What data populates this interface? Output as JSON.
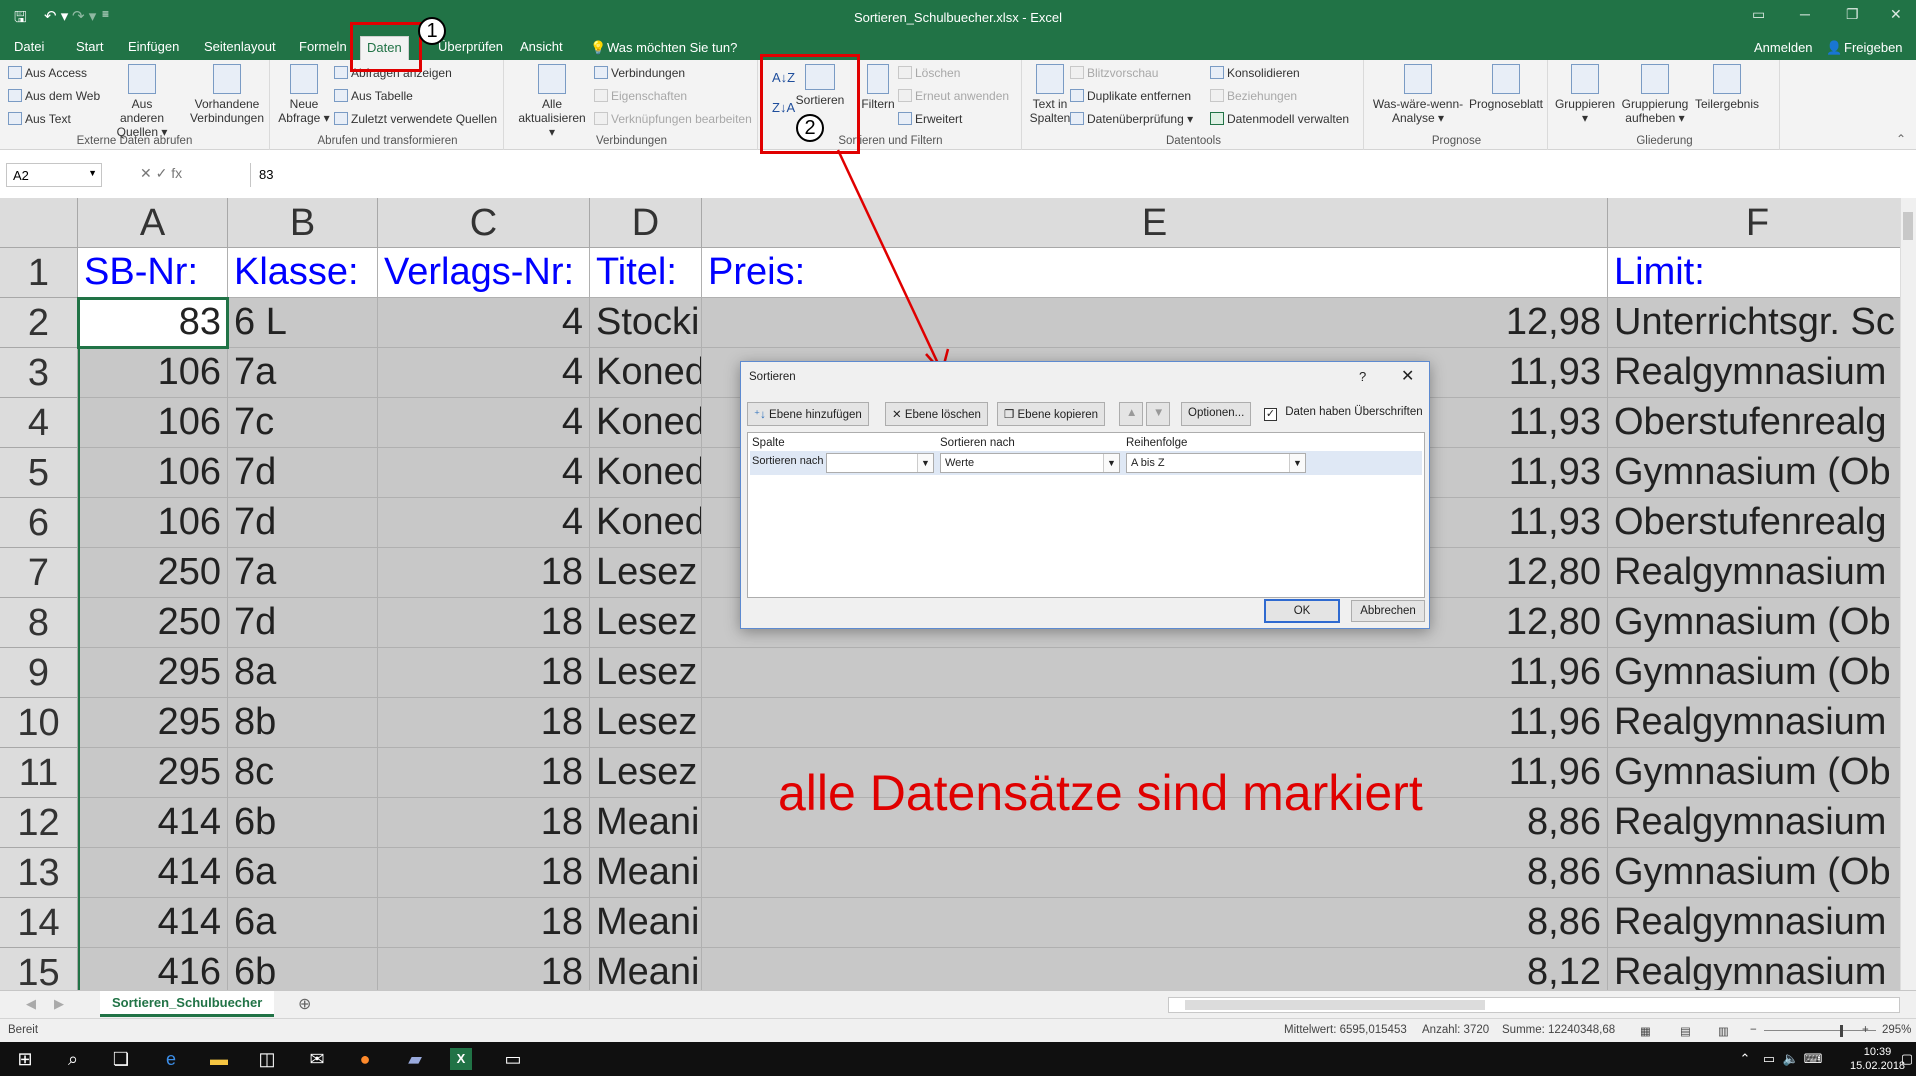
{
  "titlebar": {
    "title": "Sortieren_Schulbuecher.xlsx - Excel",
    "qa_save": "🖫",
    "qa_undo": "↶ ▾",
    "qa_redo": "↷ ▾",
    "qa_more": "≡"
  },
  "menu": {
    "tabs": [
      "Datei",
      "Start",
      "Einfügen",
      "Seitenlayout",
      "Formeln",
      "Daten",
      "Überprüfen",
      "Ansicht"
    ],
    "tell_me": "Was möchten Sie tun?",
    "signin": "Anmelden",
    "share": "Freigeben"
  },
  "ribbon": {
    "ext": {
      "access": "Aus Access",
      "web": "Aus dem Web",
      "text": "Aus Text",
      "other_l1": "Aus anderen",
      "other_l2": "Quellen ▾",
      "existing_l1": "Vorhandene",
      "existing_l2": "Verbindungen",
      "label": "Externe Daten abrufen"
    },
    "transform": {
      "newq_l1": "Neue",
      "newq_l2": "Abfrage ▾",
      "show": "Abfragen anzeigen",
      "table": "Aus Tabelle",
      "recent": "Zuletzt verwendete Quellen",
      "label": "Abrufen und transformieren"
    },
    "connections": {
      "refresh_l1": "Alle",
      "refresh_l2": "aktualisieren ▾",
      "conns": "Verbindungen",
      "props": "Eigenschaften",
      "links": "Verknüpfungen bearbeiten",
      "label": "Verbindungen"
    },
    "sort": {
      "sort": "Sortieren",
      "filter": "Filtern",
      "clear": "Löschen",
      "reapply": "Erneut anwenden",
      "advanced": "Erweitert",
      "label": "Sortieren und Filtern"
    },
    "tools": {
      "ttc_l1": "Text in",
      "ttc_l2": "Spalten",
      "flash": "Blitzvorschau",
      "dupes": "Duplikate entfernen",
      "validate": "Datenüberprüfung ▾",
      "consolidate": "Konsolidieren",
      "relations": "Beziehungen",
      "model": "Datenmodell verwalten",
      "label": "Datentools"
    },
    "forecast": {
      "whatif_l1": "Was-wäre-wenn-",
      "whatif_l2": "Analyse ▾",
      "sheet": "Prognoseblatt",
      "label": "Prognose"
    },
    "outline": {
      "group_l1": "Gruppieren",
      "group_l2": "▾",
      "ungroup_l1": "Gruppierung",
      "ungroup_l2": "aufheben ▾",
      "subtotal": "Teilergebnis",
      "label": "Gliederung"
    }
  },
  "formula_bar": {
    "namebox": "A2",
    "fx": "✕   ✓   fx",
    "value": "83"
  },
  "grid": {
    "columns": [
      "A",
      "B",
      "C",
      "D",
      "E",
      "F"
    ],
    "header_row": [
      "SB-Nr:",
      "Klasse:",
      "Verlags-Nr:",
      "Titel:",
      "Preis:",
      "Limit:"
    ],
    "rows": [
      [
        "83",
        "6 L",
        "4",
        "Stocki",
        "12,98",
        "Unterrichtsgr. Sc"
      ],
      [
        "106",
        "7a",
        "4",
        "Koned",
        "11,93",
        "Realgymnasium"
      ],
      [
        "106",
        "7c",
        "4",
        "Koned",
        "11,93",
        "Oberstufenrealg"
      ],
      [
        "106",
        "7d",
        "4",
        "Koned",
        "11,93",
        "Gymnasium (Ob"
      ],
      [
        "106",
        "7d",
        "4",
        "Koned",
        "11,93",
        "Oberstufenrealg"
      ],
      [
        "250",
        "7a",
        "18",
        "Lesez",
        "12,80",
        "Realgymnasium"
      ],
      [
        "250",
        "7d",
        "18",
        "Lesez",
        "12,80",
        "Gymnasium (Ob"
      ],
      [
        "295",
        "8a",
        "18",
        "Lesez",
        "11,96",
        "Gymnasium (Ob"
      ],
      [
        "295",
        "8b",
        "18",
        "Lesez",
        "11,96",
        "Realgymnasium"
      ],
      [
        "295",
        "8c",
        "18",
        "Lesez",
        "11,96",
        "Gymnasium (Ob"
      ],
      [
        "414",
        "6b",
        "18",
        "Meani",
        "8,86",
        "Realgymnasium"
      ],
      [
        "414",
        "6a",
        "18",
        "Meani",
        "8,86",
        "Gymnasium (Ob"
      ],
      [
        "414",
        "6a",
        "18",
        "Meani",
        "8,86",
        "Realgymnasium"
      ],
      [
        "416",
        "6b",
        "18",
        "Meani",
        "8,12",
        "Realgymnasium"
      ]
    ],
    "row_numbers": [
      "1",
      "2",
      "3",
      "4",
      "5",
      "6",
      "7",
      "8",
      "9",
      "10",
      "11",
      "12",
      "13",
      "14",
      "15"
    ]
  },
  "sheet": {
    "tab": "Sortieren_Schulbuecher",
    "add": "⊕"
  },
  "status": {
    "ready": "Bereit",
    "average": "Mittelwert: 6595,015453",
    "count": "Anzahl: 3720",
    "sum": "Summe: 12240348,68",
    "zoom": "295%"
  },
  "taskbar": {
    "time": "10:39",
    "date": "15.02.2018"
  },
  "dialog": {
    "title": "Sortieren",
    "help": "?",
    "close": "✕",
    "add_level": "Ebene hinzufügen",
    "delete_level": "Ebene löschen",
    "copy_level": "Ebene kopieren",
    "options": "Optionen...",
    "has_headers": "Daten haben Überschriften",
    "col_header": "Spalte",
    "sorton_header": "Sortieren nach",
    "order_header": "Reihenfolge",
    "row_label": "Sortieren nach",
    "column_value": "",
    "sorton_value": "Werte",
    "order_value": "A bis Z",
    "ok": "OK",
    "cancel": "Abbrechen"
  },
  "annotations": {
    "step1": "1",
    "step2": "2",
    "note": "alle Datensätze sind markiert",
    "accent_color": "#e00000"
  }
}
